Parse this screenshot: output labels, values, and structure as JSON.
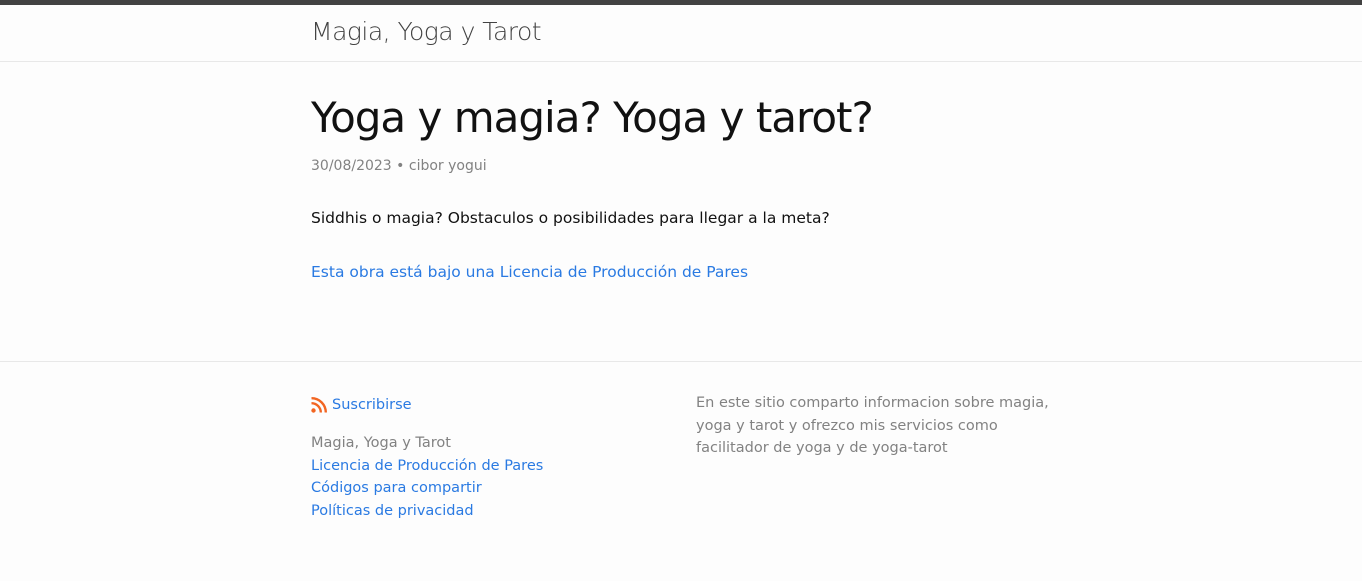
{
  "header": {
    "site_title": "Magia, Yoga y Tarot"
  },
  "post": {
    "title": "Yoga y magia? Yoga y tarot?",
    "date": "30/08/2023",
    "separator": "•",
    "author": "cibor yogui",
    "body": "Siddhis o magia? Obstaculos o posibilidades para llegar a la meta?",
    "license_link": "Esta obra está bajo una Licencia de Producción de Pares"
  },
  "footer": {
    "subscribe_label": "Suscribirse",
    "site_name": "Magia, Yoga y Tarot",
    "links": [
      "Licencia de Producción de Pares",
      "Códigos para compartir",
      "Políticas de privacidad"
    ],
    "description": "En este sitio comparto informacion sobre magia, yoga y tarot y ofrezco mis servicios como facilitador de yoga y de yoga-tarot"
  },
  "colors": {
    "link": "#2a7ae2",
    "rss": "#f26522",
    "meta_text": "#828282",
    "top_bar": "#424242"
  },
  "icons": {
    "rss": "rss-feed-icon"
  }
}
